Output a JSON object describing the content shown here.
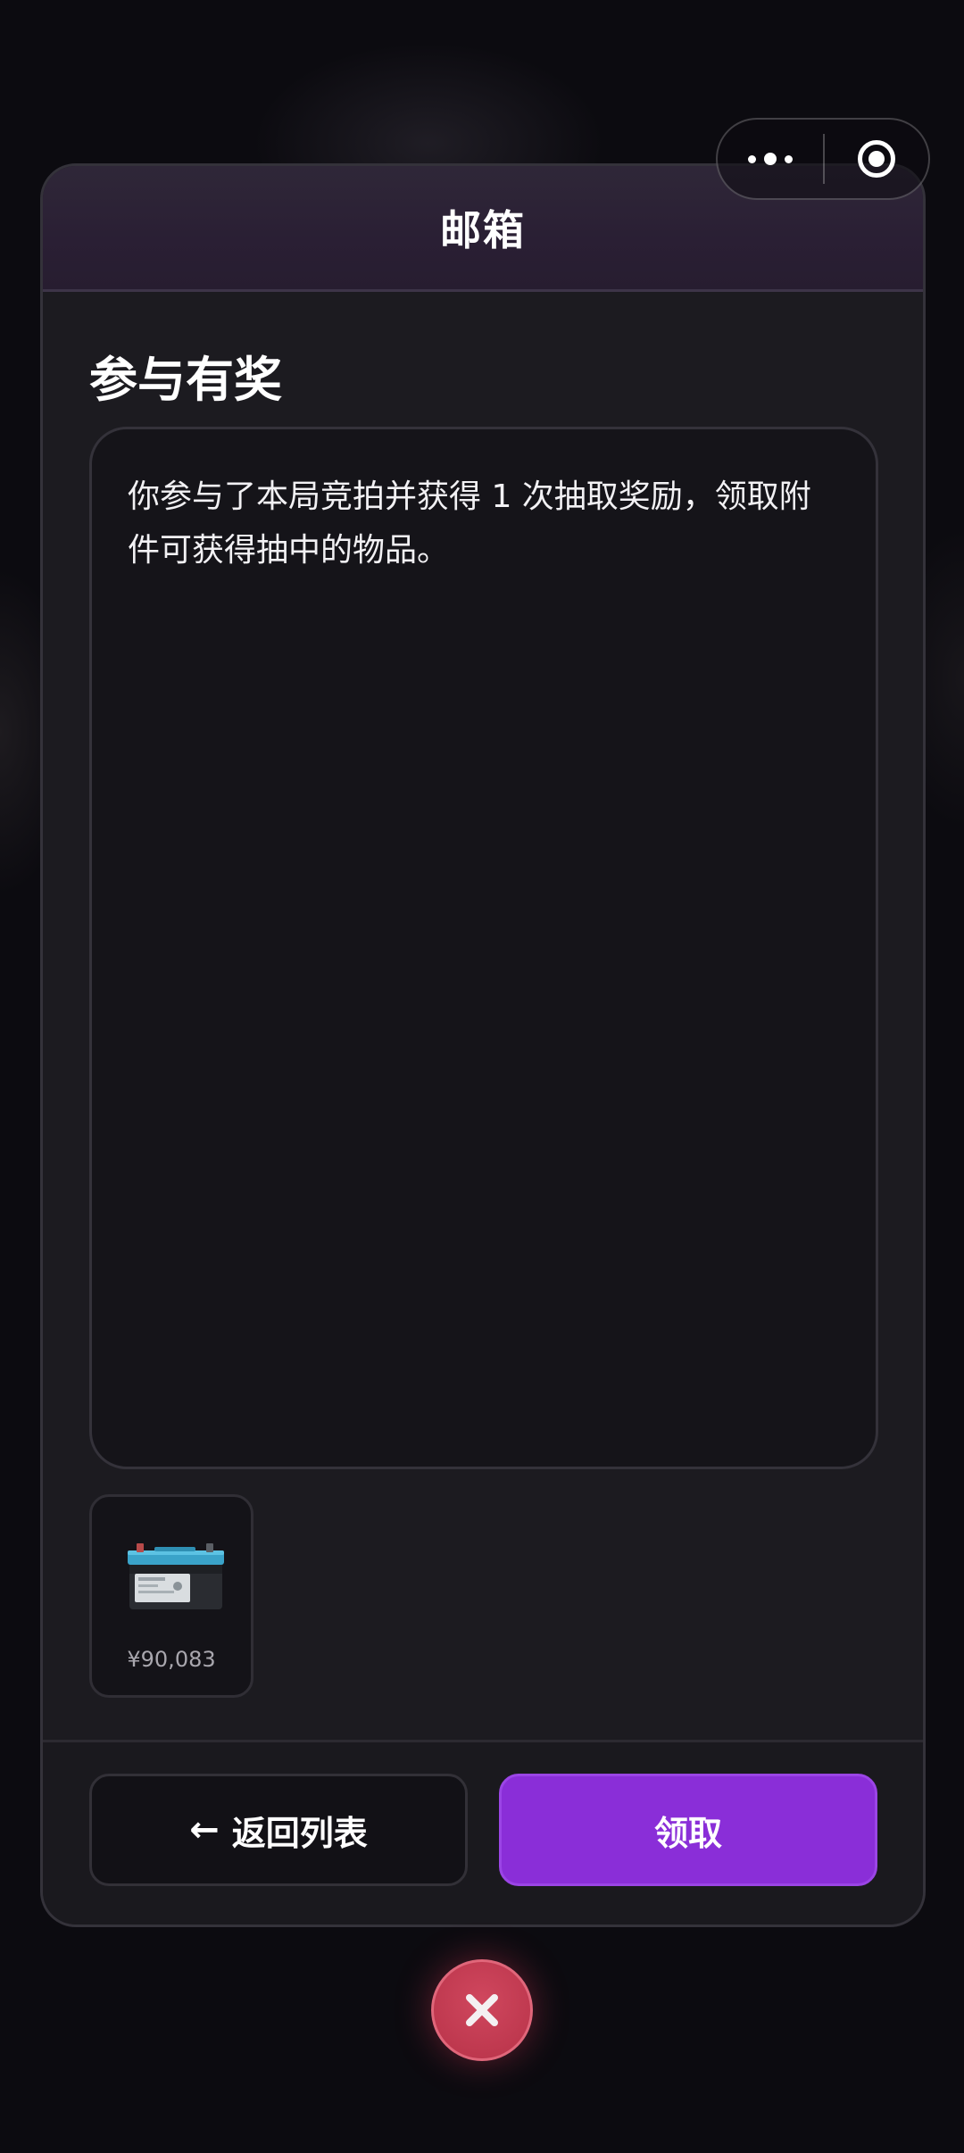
{
  "header": {
    "title": "邮箱"
  },
  "capsule": {
    "more_icon": "more-dots-icon",
    "close_icon": "target-circle-icon"
  },
  "mail": {
    "subject": "参与有奖",
    "body": "你参与了本局竞拍并获得 1 次抽取奖励，领取附件可获得抽中的物品。",
    "attachments": [
      {
        "icon": "car-battery-icon",
        "price": "¥90,083"
      }
    ]
  },
  "footer": {
    "back_arrow": "←",
    "back_label": "返回列表",
    "claim_label": "领取"
  },
  "colors": {
    "accent": "#8a2ed8",
    "close": "#c23a50",
    "surface": "#1c1b20"
  },
  "close_icon": "close-x-icon"
}
